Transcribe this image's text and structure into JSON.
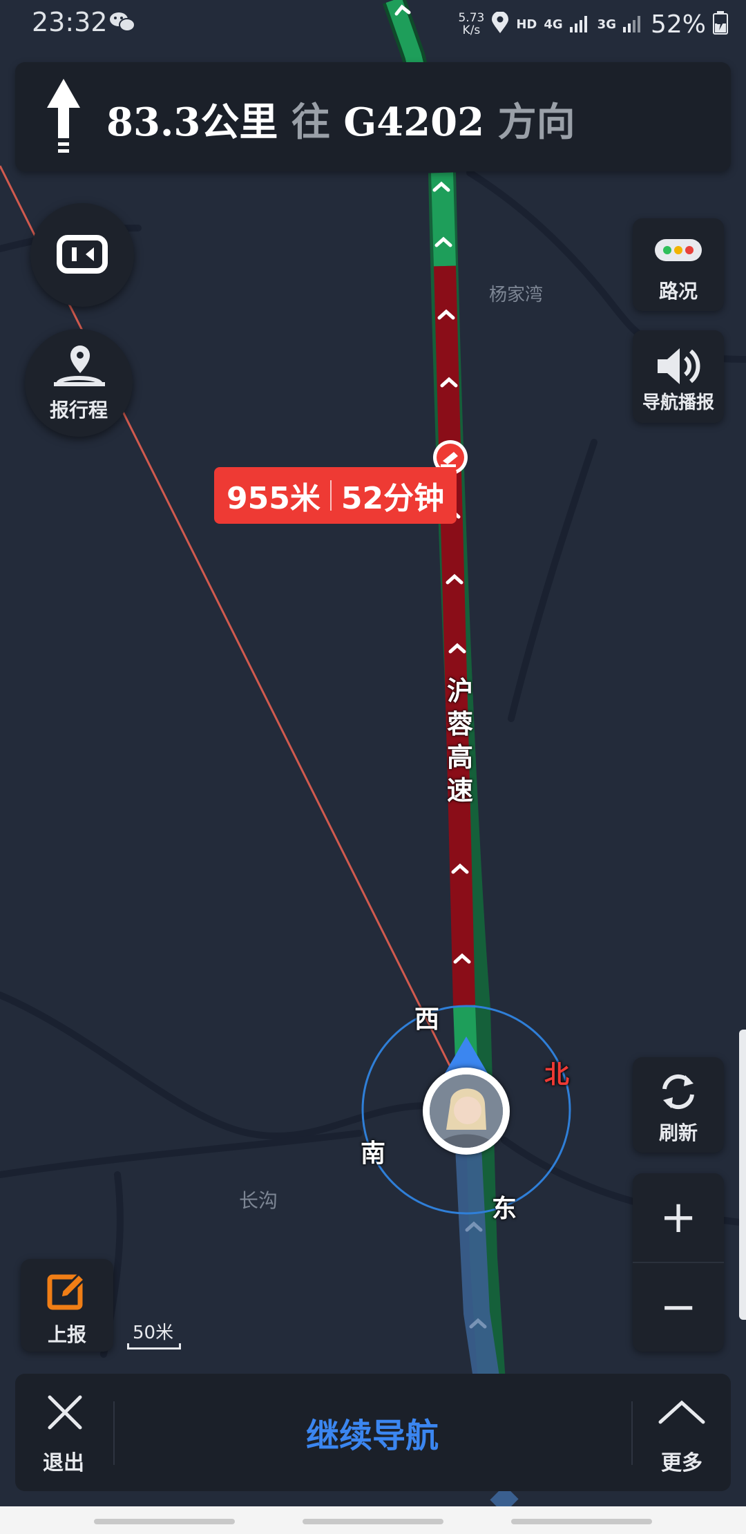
{
  "status_bar": {
    "time": "23:32",
    "net_speed": "5.73",
    "net_unit": "K/s",
    "hd": "HD",
    "net_type_a": "4G",
    "net_type_b": "3G",
    "battery": "52%"
  },
  "direction_banner": {
    "distance": "83.3公里",
    "toward": "往",
    "road": "G4202",
    "suffix": "方向"
  },
  "left_controls": {
    "report_trip_label": "报行程"
  },
  "right_controls": {
    "traffic_label": "路况",
    "voice_label": "导航播报",
    "refresh_label": "刷新",
    "zoom_in": "+",
    "zoom_out": "−"
  },
  "map": {
    "place_yangjiawan": "杨家湾",
    "place_changgou": "长沟",
    "road_name": "沪蓉高速",
    "jam_distance": "955米",
    "jam_time": "52分钟",
    "compass_west": "西",
    "compass_north": "北",
    "compass_south": "南",
    "compass_east": "东"
  },
  "report": {
    "label": "上报"
  },
  "scale": {
    "label": "50米"
  },
  "bottom_bar": {
    "exit_label": "退出",
    "continue_label": "继续导航",
    "more_label": "更多"
  },
  "colors": {
    "route_green": "#1e9e5a",
    "congestion": "#8a0d18",
    "alert_red": "#ee3a34",
    "map_bg": "#232b3a",
    "accent_blue": "#3b86f0"
  }
}
